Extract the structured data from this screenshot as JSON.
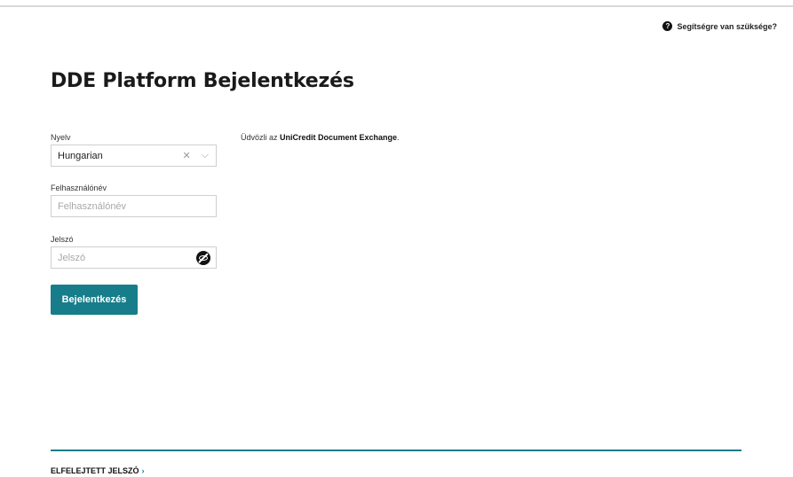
{
  "help": {
    "label": "Segítségre van szüksége?",
    "icon": "?"
  },
  "page_title": "DDE Platform Bejelentkezés",
  "form": {
    "language": {
      "label": "Nyelv",
      "value": "Hungarian"
    },
    "username": {
      "label": "Felhasználónév",
      "placeholder": "Felhasználónév"
    },
    "password": {
      "label": "Jelszó",
      "placeholder": "Jelszó"
    },
    "login_button": "Bejelentkezés"
  },
  "welcome": {
    "prefix": "Üdvözli az ",
    "brand": "UniCredit Document Exchange",
    "suffix": "."
  },
  "footer": {
    "forgot_password": "ELFELEJTETT JELSZÓ",
    "chevron": "›"
  },
  "colors": {
    "accent": "#177d8a"
  }
}
